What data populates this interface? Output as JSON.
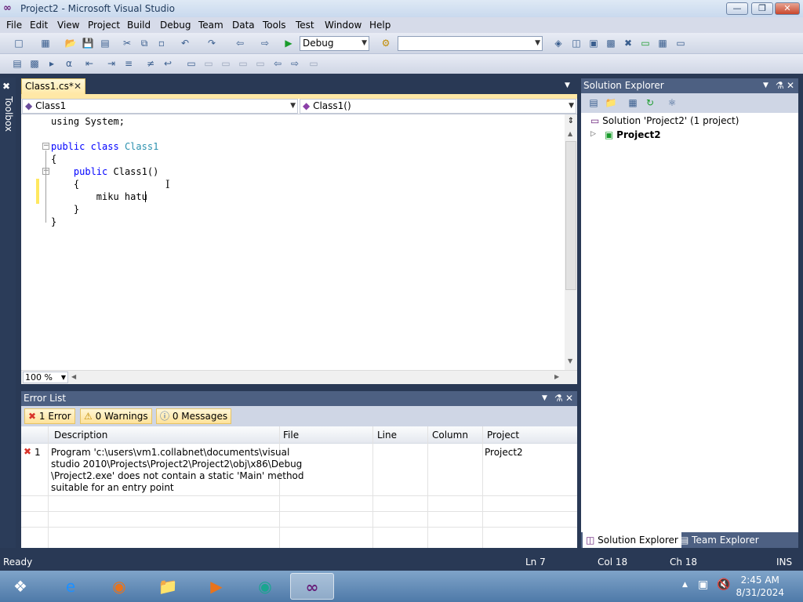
{
  "window": {
    "title": "Project2 - Microsoft Visual Studio",
    "logo_icon": "vs-infinity-icon"
  },
  "menu": [
    "File",
    "Edit",
    "View",
    "Project",
    "Build",
    "Debug",
    "Team",
    "Data",
    "Tools",
    "Test",
    "Window",
    "Help"
  ],
  "toolbar": {
    "config_value": "Debug",
    "find_value": ""
  },
  "toolbox": {
    "label": "Toolbox"
  },
  "editor": {
    "tab_label": "Class1.cs*",
    "nav_left": "Class1",
    "nav_right": "Class1()",
    "code_lines": [
      {
        "indent": "",
        "parts": [
          {
            "t": "using System;",
            "c": ""
          }
        ]
      },
      {
        "indent": "",
        "parts": [
          {
            "t": "",
            "c": ""
          }
        ]
      },
      {
        "indent": "",
        "parts": [
          {
            "t": "public",
            "c": "kw"
          },
          {
            "t": " ",
            "c": ""
          },
          {
            "t": "class",
            "c": "kw"
          },
          {
            "t": " ",
            "c": ""
          },
          {
            "t": "Class1",
            "c": "ty"
          }
        ]
      },
      {
        "indent": "",
        "parts": [
          {
            "t": "{",
            "c": ""
          }
        ]
      },
      {
        "indent": "    ",
        "parts": [
          {
            "t": "public",
            "c": "kw"
          },
          {
            "t": " Class1()",
            "c": ""
          }
        ]
      },
      {
        "indent": "    ",
        "parts": [
          {
            "t": "{",
            "c": ""
          }
        ]
      },
      {
        "indent": "        ",
        "parts": [
          {
            "t": "miku hatu",
            "c": ""
          }
        ]
      },
      {
        "indent": "    ",
        "parts": [
          {
            "t": "}",
            "c": ""
          }
        ]
      },
      {
        "indent": "",
        "parts": [
          {
            "t": "}",
            "c": ""
          }
        ]
      }
    ],
    "zoom": "100 %"
  },
  "error_list": {
    "title": "Error List",
    "filters": {
      "errors": "1 Error",
      "warnings": "0 Warnings",
      "messages": "0 Messages"
    },
    "columns": {
      "description": "Description",
      "file": "File",
      "line": "Line",
      "column": "Column",
      "project": "Project"
    },
    "rows": [
      {
        "number": "1",
        "description_lines": [
          "Program 'c:\\users\\vm1.collabnet\\documents\\visual",
          "studio 2010\\Projects\\Project2\\Project2\\obj\\x86\\Debug",
          "\\Project2.exe' does not contain a static 'Main' method",
          "suitable for an entry point"
        ],
        "file": "",
        "line": "",
        "column": "",
        "project": "Project2"
      }
    ]
  },
  "solution_explorer": {
    "title": "Solution Explorer",
    "solution_label": "Solution 'Project2' (1 project)",
    "project_label": "Project2",
    "tab_solution": "Solution Explorer",
    "tab_team": "Team Explorer"
  },
  "status": {
    "text": "Ready",
    "ln": "Ln 7",
    "col": "Col 18",
    "ch": "Ch 18",
    "mode": "INS"
  },
  "taskbar": {
    "time": "2:45 AM",
    "date": "8/31/2024"
  },
  "colors": {
    "keyword": "#0000ff",
    "type": "#2b91af",
    "chrome": "#293955",
    "panel_title": "#4d6082",
    "error_red": "#d9342b"
  }
}
